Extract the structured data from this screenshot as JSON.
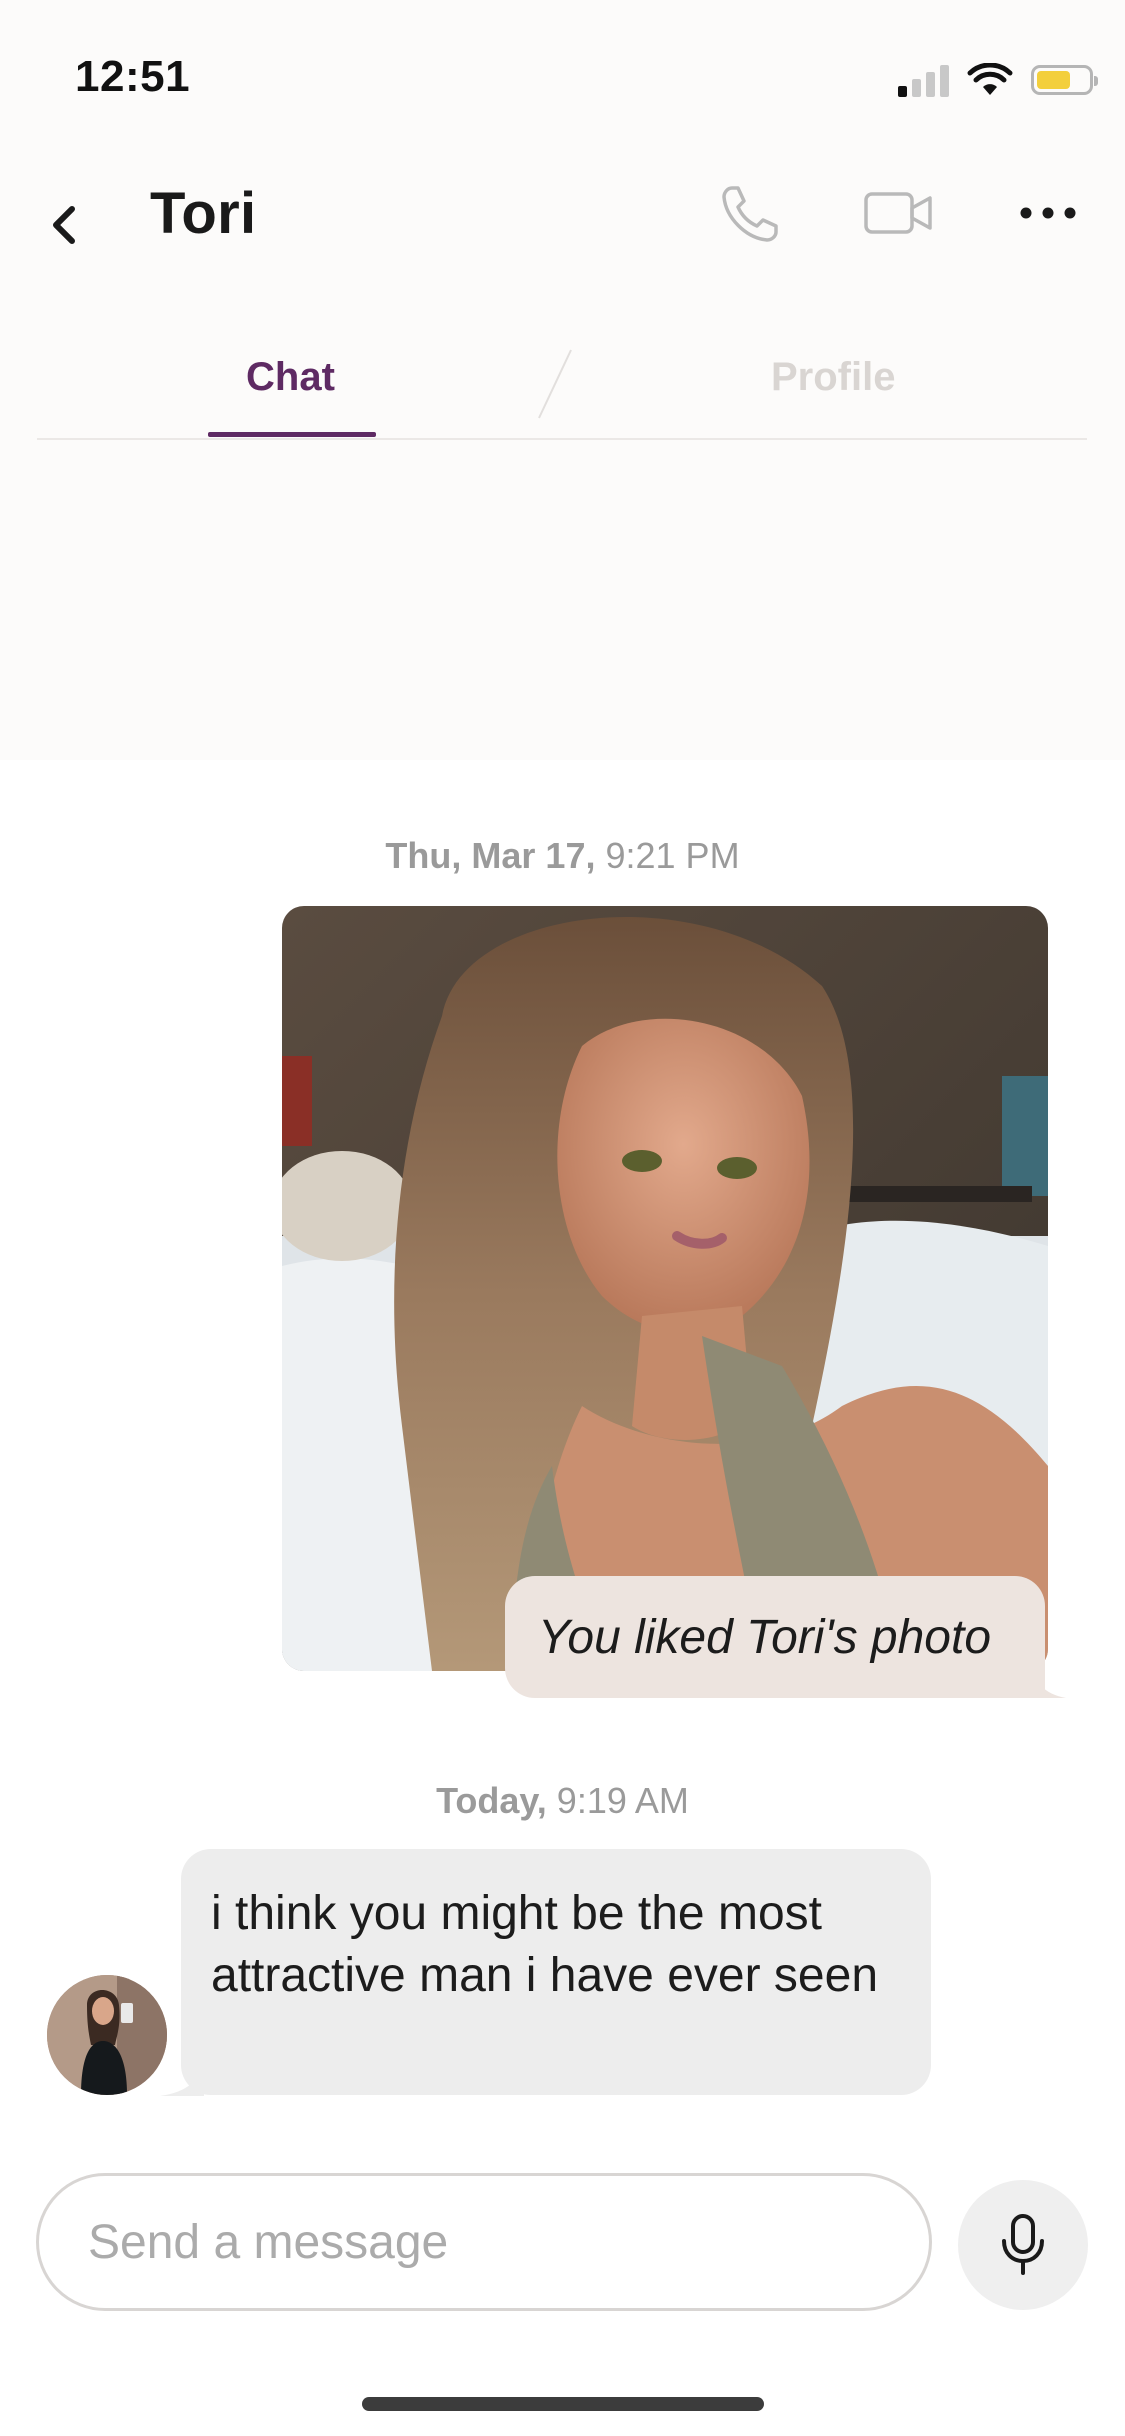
{
  "status_bar": {
    "time": "12:51",
    "icons": [
      "cellular-signal-icon",
      "wifi-icon",
      "battery-icon"
    ],
    "battery_color": "#f3cf3c"
  },
  "header": {
    "title": "Tori",
    "icons": [
      "back-chevron-icon",
      "phone-icon",
      "video-camera-icon",
      "more-dots-icon"
    ]
  },
  "tabs": {
    "chat": "Chat",
    "profile": "Profile",
    "active": "Chat",
    "accent_color": "#5e2a63"
  },
  "messages": {
    "first": {
      "day": "Thu, Mar 17,",
      "time": "9:21 PM",
      "reaction_text": "You liked Tori's photo"
    },
    "second": {
      "day": "Today,",
      "time": "9:19 AM",
      "text": "i think you might be the most attractive man i have ever seen"
    }
  },
  "composer": {
    "placeholder": "Send a message",
    "value": ""
  }
}
